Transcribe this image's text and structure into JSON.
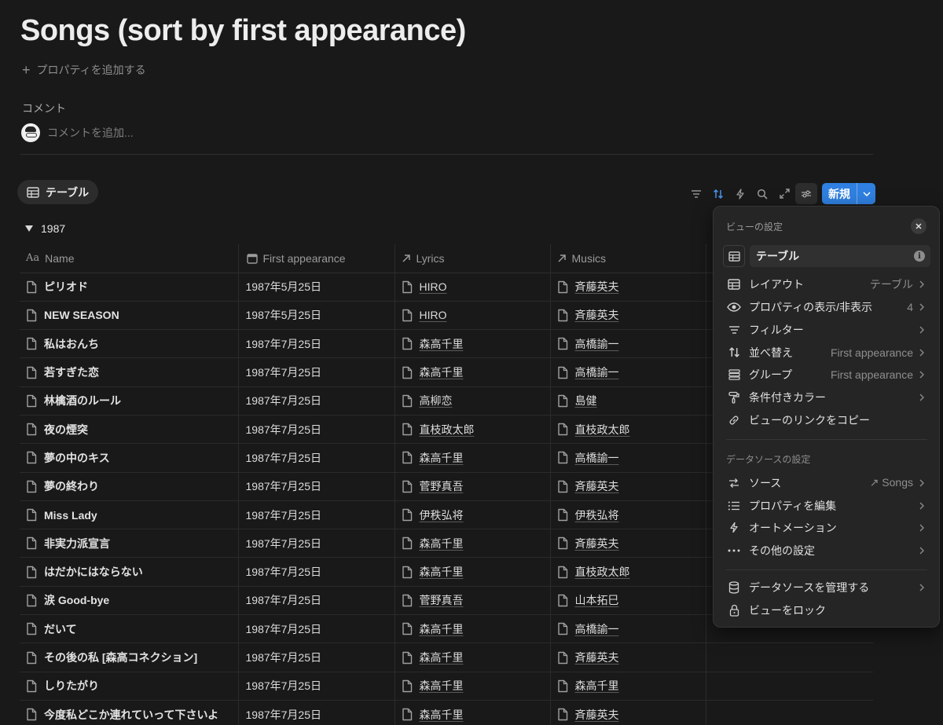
{
  "page": {
    "title": "Songs (sort by first appearance)",
    "add_property": "プロパティを追加する",
    "comment_label": "コメント",
    "comment_placeholder": "コメントを追加..."
  },
  "view": {
    "tab_label": "テーブル"
  },
  "toolbar": {
    "new_label": "新規"
  },
  "group": {
    "label": "1987"
  },
  "columns": [
    "Name",
    "First appearance",
    "Lyrics",
    "Musics"
  ],
  "rows": [
    {
      "name": "ピリオド",
      "date": "1987年5月25日",
      "lyrics": "HIRO",
      "musics": "斉藤英夫"
    },
    {
      "name": "NEW SEASON",
      "date": "1987年5月25日",
      "lyrics": "HIRO",
      "musics": "斉藤英夫"
    },
    {
      "name": "私はおんち",
      "date": "1987年7月25日",
      "lyrics": "森高千里",
      "musics": "高橋諭一"
    },
    {
      "name": "若すぎた恋",
      "date": "1987年7月25日",
      "lyrics": "森高千里",
      "musics": "高橋諭一"
    },
    {
      "name": "林檎酒のルール",
      "date": "1987年7月25日",
      "lyrics": "高柳恋",
      "musics": "島健"
    },
    {
      "name": "夜の煙突",
      "date": "1987年7月25日",
      "lyrics": "直枝政太郎",
      "musics": "直枝政太郎"
    },
    {
      "name": "夢の中のキス",
      "date": "1987年7月25日",
      "lyrics": "森高千里",
      "musics": "高橋諭一"
    },
    {
      "name": "夢の終わり",
      "date": "1987年7月25日",
      "lyrics": "菅野真吾",
      "musics": "斉藤英夫"
    },
    {
      "name": "Miss Lady",
      "date": "1987年7月25日",
      "lyrics": "伊秩弘将",
      "musics": "伊秩弘将"
    },
    {
      "name": "非実力派宣言",
      "date": "1987年7月25日",
      "lyrics": "森高千里",
      "musics": "斉藤英夫"
    },
    {
      "name": "はだかにはならない",
      "date": "1987年7月25日",
      "lyrics": "森高千里",
      "musics": "直枝政太郎"
    },
    {
      "name": "涙 Good-bye",
      "date": "1987年7月25日",
      "lyrics": "菅野真吾",
      "musics": "山本拓巳"
    },
    {
      "name": "だいて",
      "date": "1987年7月25日",
      "lyrics": "森高千里",
      "musics": "高橋諭一"
    },
    {
      "name": "その後の私 [森高コネクション]",
      "date": "1987年7月25日",
      "lyrics": "森高千里",
      "musics": "斉藤英夫"
    },
    {
      "name": "しりたがり",
      "date": "1987年7月25日",
      "lyrics": "森高千里",
      "musics": "森高千里"
    },
    {
      "name": "今度私どこか連れていって下さいよ",
      "date": "1987年7月25日",
      "lyrics": "森高千里",
      "musics": "斉藤英夫"
    }
  ],
  "panel": {
    "title": "ビューの設定",
    "view_name": "テーブル",
    "items": [
      {
        "icon": "table-icon",
        "label": "レイアウト",
        "value": "テーブル"
      },
      {
        "icon": "eye-icon",
        "label": "プロパティの表示/非表示",
        "value": "4"
      },
      {
        "icon": "filter-icon",
        "label": "フィルター",
        "value": ""
      },
      {
        "icon": "sort-icon",
        "label": "並べ替え",
        "value": "First appearance"
      },
      {
        "icon": "group-icon",
        "label": "グループ",
        "value": "First appearance"
      },
      {
        "icon": "paint-roller-icon",
        "label": "条件付きカラー",
        "value": ""
      },
      {
        "icon": "link-icon",
        "label": "ビューのリンクをコピー",
        "value": ""
      }
    ],
    "datasource_title": "データソースの設定",
    "datasource_items": [
      {
        "icon": "source-icon",
        "label": "ソース",
        "value": "↗ Songs"
      },
      {
        "icon": "list-icon",
        "label": "プロパティを編集",
        "value": ""
      },
      {
        "icon": "lightning-icon",
        "label": "オートメーション",
        "value": ""
      },
      {
        "icon": "more-icon",
        "label": "その他の設定",
        "value": ""
      }
    ],
    "bottom_items": [
      {
        "icon": "database-icon",
        "label": "データソースを管理する",
        "value": ""
      },
      {
        "icon": "lock-icon",
        "label": "ビューをロック",
        "value": ""
      }
    ]
  },
  "colors": {
    "accent": "#2f80e0",
    "background": "#191919",
    "panel": "#252525"
  }
}
